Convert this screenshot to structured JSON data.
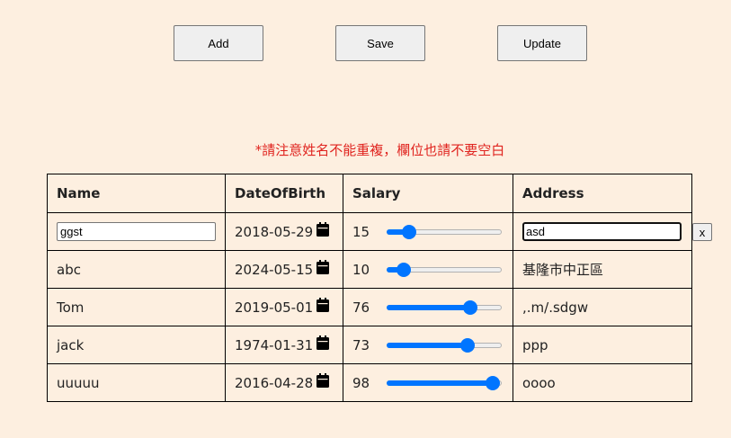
{
  "toolbar": {
    "add_label": "Add",
    "save_label": "Save",
    "update_label": "Update"
  },
  "notice": "*請注意姓名不能重複，欄位也請不要空白",
  "table": {
    "headers": [
      "Name",
      "DateOfBirth",
      "Salary",
      "Address"
    ],
    "salary_max": 100,
    "editing_row": {
      "name": "ggst",
      "date_of_birth": "2018-05-29",
      "salary": 15,
      "address": "asd",
      "remove_label": "x"
    },
    "rows": [
      {
        "name": "abc",
        "date_of_birth": "2024-05-15",
        "salary": 10,
        "address": "基隆市中正區"
      },
      {
        "name": "Tom",
        "date_of_birth": "2019-05-01",
        "salary": 76,
        "address": ",.m/.sdgw"
      },
      {
        "name": "jack",
        "date_of_birth": "1974-01-31",
        "salary": 73,
        "address": "ppp"
      },
      {
        "name": "uuuuu",
        "date_of_birth": "2016-04-28",
        "salary": 98,
        "address": "oooo"
      }
    ]
  },
  "colors": {
    "background": "#fdefe0",
    "accent": "#0075ff",
    "notice": "#e0241f"
  },
  "icons": {
    "date_picker": "calendar-icon"
  }
}
